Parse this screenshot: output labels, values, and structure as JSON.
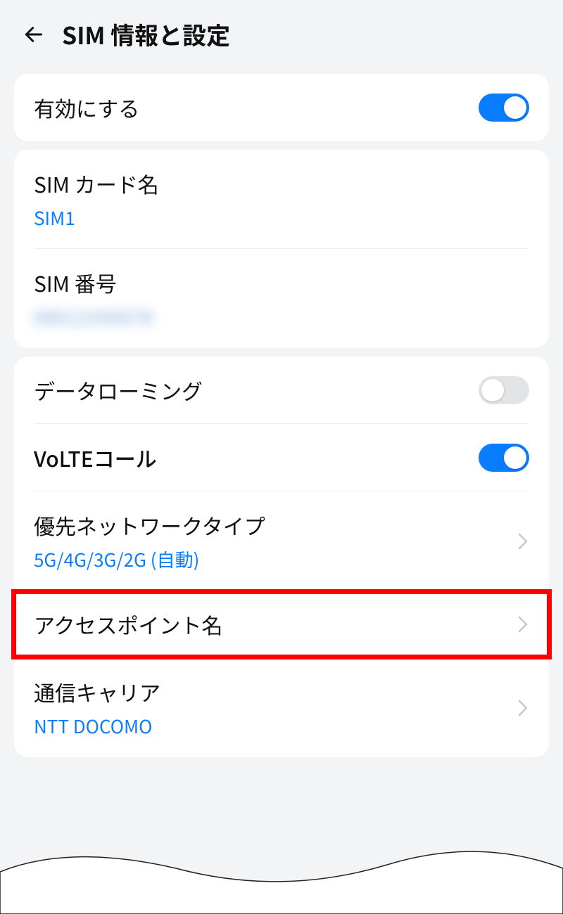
{
  "header": {
    "title": "SIM 情報と設定"
  },
  "enable": {
    "label": "有効にする",
    "on": true
  },
  "sim_info": {
    "card_name_label": "SIM カード名",
    "card_name_value": "SIM1",
    "number_label": "SIM 番号",
    "number_value": "08012345678"
  },
  "network": {
    "roaming_label": "データローミング",
    "roaming_on": false,
    "volte_label": "VoLTEコール",
    "volte_on": true,
    "priority_label": "優先ネットワークタイプ",
    "priority_value": "5G/4G/3G/2G (自動)",
    "apn_label": "アクセスポイント名",
    "carrier_label": "通信キャリア",
    "carrier_value": "NTT DOCOMO"
  },
  "highlight": {
    "target": "apn"
  }
}
